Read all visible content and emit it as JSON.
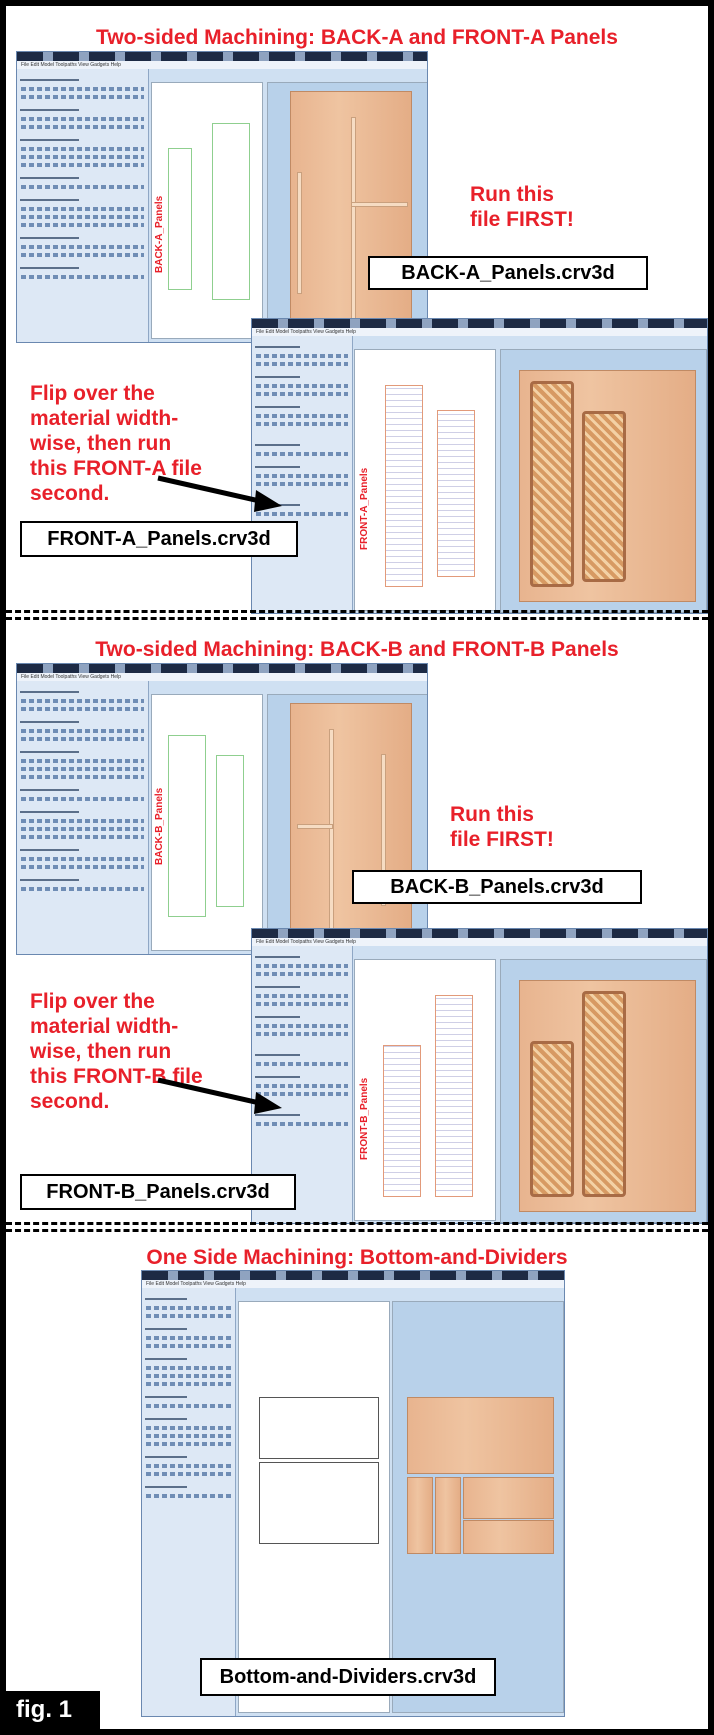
{
  "sections": [
    {
      "heading": "Two-sided Machining: BACK-A and FRONT-A Panels",
      "back_note": "Run this file FIRST!",
      "back_file": "BACK-A_Panels.crv3d",
      "back_label": "BACK-A_Panels",
      "front_note": "Flip over the material width-wise, then run this FRONT-A file second.",
      "front_file": "FRONT-A_Panels.crv3d",
      "front_label": "FRONT-A_Panels"
    },
    {
      "heading": "Two-sided Machining: BACK-B and FRONT-B Panels",
      "back_note": "Run this file FIRST!",
      "back_file": "BACK-B_Panels.crv3d",
      "back_label": "BACK-B_Panels",
      "front_note": "Flip over the material width-wise, then run this FRONT-B file second.",
      "front_file": "FRONT-B_Panels.crv3d",
      "front_label": "FRONT-B_Panels"
    }
  ],
  "bottom": {
    "heading": "One Side Machining: Bottom-and-Dividers",
    "file": "Bottom-and-Dividers.crv3d"
  },
  "app": {
    "menu": "File  Edit  Model  Toolpaths  View  Gadgets  Help"
  },
  "figure_label": "fig. 1",
  "colors": {
    "heading_red": "#e8202a",
    "frame": "#000000"
  }
}
